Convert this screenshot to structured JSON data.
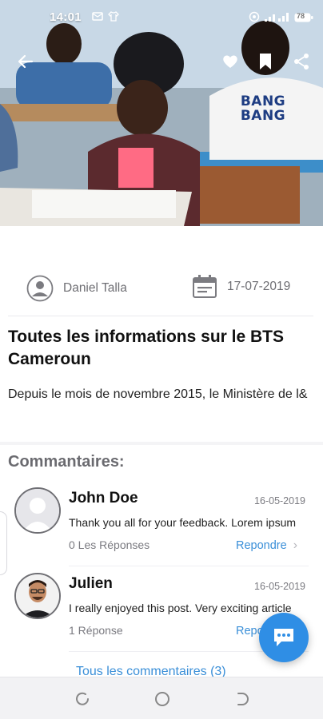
{
  "status_bar": {
    "time": "14:01",
    "battery": "78"
  },
  "article": {
    "author": "Daniel Talla",
    "date": "17-07-2019",
    "title": "Toutes les informations sur le BTS Cameroun",
    "excerpt": "Depuis le mois de novembre 2015, le Ministère de l&",
    "hero_shirt_text": [
      "BANG",
      "BANG"
    ]
  },
  "comments": {
    "heading": "Commantaires:",
    "items": [
      {
        "name": "John Doe",
        "date": "16-05-2019",
        "text": "Thank you all for your feedback. Lorem ipsum",
        "replies": "0 Les Réponses",
        "reply_label": "Repondre"
      },
      {
        "name": "Julien",
        "date": "16-05-2019",
        "text": "I really enjoyed this post. Very exciting article",
        "replies": "1 Réponse",
        "reply_label": "Repondre"
      }
    ],
    "all_link": "Tous les commentaires (3)"
  },
  "icons": {
    "back": "arrow-left-icon",
    "like": "heart-icon",
    "bookmark": "bookmark-icon",
    "share": "share-icon",
    "author": "user-circle-icon",
    "date": "calendar-icon",
    "fab": "chat-bubble-icon"
  },
  "colors": {
    "accent": "#2f8ee5",
    "link": "#3a8fd8",
    "muted": "#6e6e73"
  }
}
